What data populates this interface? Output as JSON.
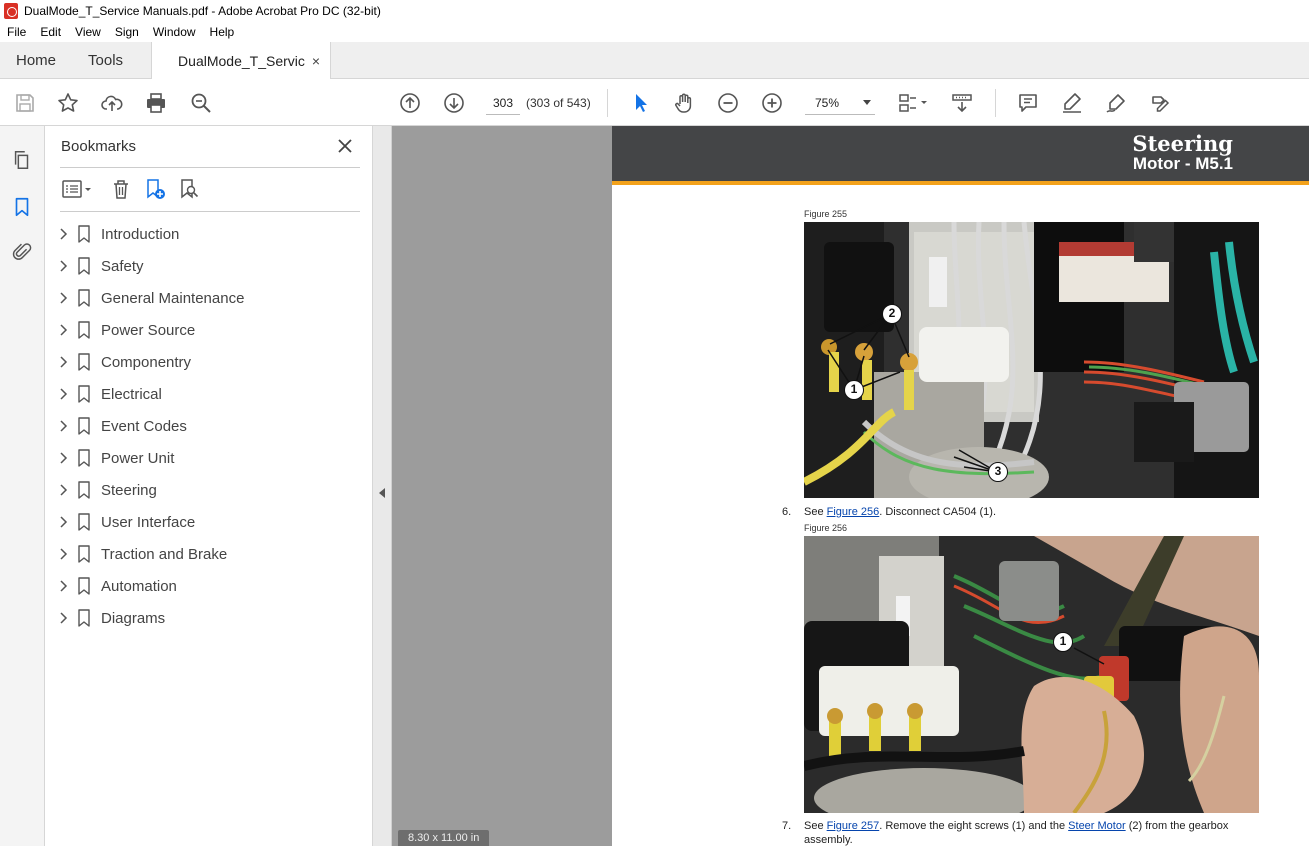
{
  "window": {
    "title": "DualMode_T_Service Manuals.pdf - Adobe Acrobat Pro DC (32-bit)"
  },
  "menu": [
    "File",
    "Edit",
    "View",
    "Sign",
    "Window",
    "Help"
  ],
  "tabs": {
    "home": "Home",
    "tools": "Tools",
    "document": "DualMode_T_Servic...",
    "close": "×"
  },
  "toolbar": {
    "page_number": "303",
    "page_count": "(303 of 543)",
    "zoom": "75%"
  },
  "bookmarks": {
    "title": "Bookmarks",
    "close": "✕",
    "items": [
      {
        "label": "Introduction"
      },
      {
        "label": "Safety"
      },
      {
        "label": "General Maintenance"
      },
      {
        "label": "Power Source"
      },
      {
        "label": "Componentry"
      },
      {
        "label": "Electrical"
      },
      {
        "label": "Event Codes"
      },
      {
        "label": "Power Unit"
      },
      {
        "label": "Steering"
      },
      {
        "label": "User Interface"
      },
      {
        "label": "Traction and Brake"
      },
      {
        "label": "Automation"
      },
      {
        "label": "Diagrams"
      }
    ]
  },
  "status": {
    "page_size": "8.30 x 11.00 in"
  },
  "page": {
    "header_title": "Steering",
    "header_subtitle": "Motor - M5.1",
    "figure1_caption": "Figure 255",
    "figure2_caption": "Figure 256",
    "callouts_fig1": [
      "2",
      "1",
      "3"
    ],
    "callouts_fig2": [
      "1"
    ],
    "step6": {
      "number": "6.",
      "prefix": "See ",
      "link": "Figure 256",
      "suffix": ". Disconnect CA504 (1)."
    },
    "step7": {
      "number": "7.",
      "prefix": "See ",
      "link1": "Figure 257",
      "middle": ". Remove the eight screws (1) and the ",
      "link2": "Steer Motor",
      "suffix": " (2) from the gearbox assembly."
    }
  },
  "colors": {
    "header_bg": "#444547",
    "header_stripe": "#f3a21b",
    "link": "#0645ad",
    "cursor_tool": "#1473e6"
  }
}
